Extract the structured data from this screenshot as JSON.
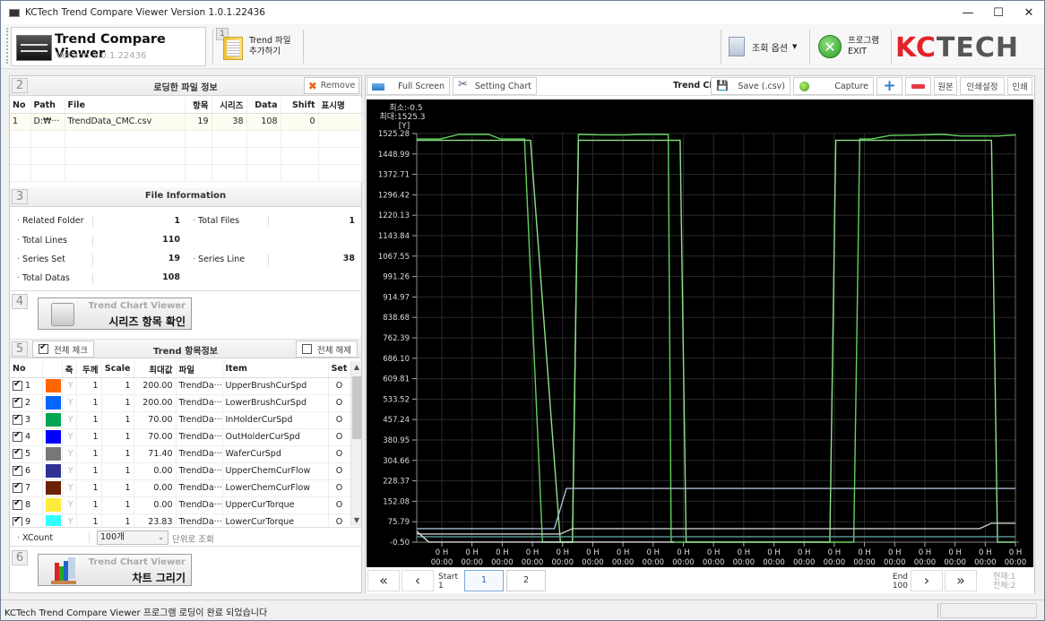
{
  "window": {
    "title": "KCTech Trend Compare Viewer Version 1.0.1.22436",
    "controls": {
      "minimize": "—",
      "maximize": "☐",
      "close": "✕"
    }
  },
  "toolbar": {
    "brand_name": "Trend Compare Viewer",
    "brand_version": "Version 1.0.1.22436",
    "add_file_step": "1",
    "add_file_line1": "Trend 파일",
    "add_file_line2": "추가하기",
    "options_label": "조회 옵션",
    "exit_line1": "프로그램",
    "exit_line2": "EXIT",
    "logo_k": "KC",
    "logo_rest": "TECH"
  },
  "loaded_files": {
    "step": "2",
    "title": "로딩한 파일 정보",
    "remove_label": "Remove",
    "columns": [
      "No",
      "Path",
      "File",
      "항목",
      "시리즈",
      "Data",
      "Shift",
      "표시명"
    ],
    "rows": [
      {
        "no": "1",
        "path": "D:₩···",
        "file": "TrendData_CMC.csv",
        "items": "19",
        "series": "38",
        "data": "108",
        "shift": "0",
        "display": ""
      }
    ]
  },
  "file_info": {
    "step": "3",
    "title": "File Information",
    "related_folder_label": "Related Folder",
    "related_folder": "1",
    "total_files_label": "Total Files",
    "total_files": "1",
    "total_lines_label": "Total Lines",
    "total_lines": "110",
    "series_set_label": "Series Set",
    "series_set": "19",
    "series_line_label": "Series Line",
    "series_line": "38",
    "total_datas_label": "Total Datas",
    "total_datas": "108"
  },
  "series_check": {
    "step": "4",
    "sub": "Trend Chart Viewer",
    "main": "시리즈 항목 확인"
  },
  "trend_items": {
    "step": "5",
    "check_all_label": "전체 체크",
    "title": "Trend 항목정보",
    "uncheck_all_label": "전체 해제",
    "columns": [
      "No",
      "",
      "축",
      "두께",
      "Scale",
      "최대값",
      "파일",
      "Item",
      "Set"
    ],
    "rows": [
      {
        "checked": true,
        "no": "1",
        "color": "#ff6600",
        "axis": "Y",
        "width": "1",
        "scale": "1",
        "max": "200.00",
        "file": "TrendDa···",
        "item": "UpperBrushCurSpd",
        "set": "O"
      },
      {
        "checked": true,
        "no": "2",
        "color": "#0066ff",
        "axis": "Y",
        "width": "1",
        "scale": "1",
        "max": "200.00",
        "file": "TrendDa···",
        "item": "LowerBrushCurSpd",
        "set": "O"
      },
      {
        "checked": true,
        "no": "3",
        "color": "#00a651",
        "axis": "Y",
        "width": "1",
        "scale": "1",
        "max": "70.00",
        "file": "TrendDa···",
        "item": "InHolderCurSpd",
        "set": "O"
      },
      {
        "checked": true,
        "no": "4",
        "color": "#0000ff",
        "axis": "Y",
        "width": "1",
        "scale": "1",
        "max": "70.00",
        "file": "TrendDa···",
        "item": "OutHolderCurSpd",
        "set": "O"
      },
      {
        "checked": true,
        "no": "5",
        "color": "#777777",
        "axis": "Y",
        "width": "1",
        "scale": "1",
        "max": "71.40",
        "file": "TrendDa···",
        "item": "WaferCurSpd",
        "set": "O"
      },
      {
        "checked": true,
        "no": "6",
        "color": "#2e3192",
        "axis": "Y",
        "width": "1",
        "scale": "1",
        "max": "0.00",
        "file": "TrendDa···",
        "item": "UpperChemCurFlow",
        "set": "O"
      },
      {
        "checked": true,
        "no": "7",
        "color": "#6b2200",
        "axis": "Y",
        "width": "1",
        "scale": "1",
        "max": "0.00",
        "file": "TrendDa···",
        "item": "LowerChemCurFlow",
        "set": "O"
      },
      {
        "checked": true,
        "no": "8",
        "color": "#ffeb3b",
        "axis": "Y",
        "width": "1",
        "scale": "1",
        "max": "0.00",
        "file": "TrendDa···",
        "item": "UpperCurTorque",
        "set": "O"
      },
      {
        "checked": true,
        "no": "9",
        "color": "#33ffff",
        "axis": "Y",
        "width": "1",
        "scale": "1",
        "max": "23.83",
        "file": "TrendDa···",
        "item": "LowerCurTorque",
        "set": "O"
      }
    ]
  },
  "xcount": {
    "label": "XCount",
    "value": "100개",
    "unit_label": "단위로 조회"
  },
  "draw_chart": {
    "step": "6",
    "sub": "Trend Chart Viewer",
    "main": "차트 그리기"
  },
  "chart_toolbar": {
    "full_screen": "Full Screen",
    "setting_chart": "Setting Chart",
    "chart_label": "Trend Ch",
    "save_csv": "Save (.csv)",
    "capture": "Capture",
    "zoom_in": "+",
    "zoom_out": "−",
    "original": "원본",
    "print_settings": "인쇄설정",
    "print": "인쇄"
  },
  "pager": {
    "first": "«",
    "prev": "‹",
    "start_label": "Start",
    "start_value": "1",
    "pages": [
      "1",
      "2"
    ],
    "active_page": "1",
    "end_label": "End",
    "end_value": "100",
    "next": "›",
    "last": "»",
    "current_label": "현재:1",
    "total_label": "전체:2"
  },
  "status": {
    "message": "KCTech Trend Compare Viewer 프로그램 로딩이 완료 되었습니다"
  },
  "chart_data": {
    "type": "line",
    "title": "",
    "min_label": "최소:-0.5",
    "max_label": "최대:1525.3",
    "ylabel": "[Y]",
    "xlabel": "",
    "ylim": [
      -0.5,
      1525.28
    ],
    "yticks": [
      "1525.28",
      "1448.99",
      "1372.71",
      "1296.42",
      "1220.13",
      "1143.84",
      "1067.55",
      "991.26",
      "914.97",
      "838.68",
      "762.39",
      "686.10",
      "609.81",
      "533.52",
      "457.24",
      "380.95",
      "304.66",
      "228.37",
      "152.08",
      "75.79",
      "-0.50"
    ],
    "ytick_values": [
      1525.28,
      1448.99,
      1372.71,
      1296.42,
      1220.13,
      1143.84,
      1067.55,
      991.26,
      914.97,
      838.68,
      762.39,
      686.1,
      609.81,
      533.52,
      457.24,
      380.95,
      304.66,
      228.37,
      152.08,
      75.79,
      -0.5
    ],
    "xlim": [
      0,
      100
    ],
    "xtick_labels": [
      "0 H\n00:00",
      "0 H\n00:00",
      "0 H\n00:00",
      "0 H\n00:00",
      "0 H\n00:00",
      "0 H\n00:00",
      "0 H\n00:00",
      "0 H\n00:00",
      "0 H\n00:00",
      "0 H\n00:00",
      "0 H\n00:00",
      "0 H\n00:00",
      "0 H\n00:00",
      "0 H\n00:00",
      "0 H\n00:00",
      "0 H\n00:00",
      "0 H\n00:00",
      "0 H\n00:00",
      "0 H\n00:00",
      "0 H\n00:00"
    ],
    "grid": true,
    "background": "#000000",
    "series": [
      {
        "name": "green-1",
        "color": "#5fd35a",
        "points": [
          [
            0,
            1505
          ],
          [
            4,
            1505
          ],
          [
            7,
            1522
          ],
          [
            12,
            1522
          ],
          [
            14,
            1505
          ],
          [
            18,
            1505
          ],
          [
            21,
            -0.5
          ],
          [
            26,
            -0.5
          ],
          [
            27,
            1522
          ],
          [
            31,
            1520
          ],
          [
            35,
            1520
          ],
          [
            37,
            1522
          ],
          [
            42,
            1522
          ],
          [
            42.5,
            -0.5
          ],
          [
            73,
            -0.5
          ],
          [
            74,
            1505
          ],
          [
            76,
            1505
          ],
          [
            79,
            1518
          ],
          [
            84,
            1520
          ],
          [
            88,
            1522
          ],
          [
            91,
            1516
          ],
          [
            97,
            1516
          ],
          [
            100,
            1520
          ]
        ]
      },
      {
        "name": "green-2",
        "color": "#8fe08a",
        "points": [
          [
            0,
            1500
          ],
          [
            18,
            1500
          ],
          [
            19,
            1500
          ],
          [
            24,
            -0.5
          ],
          [
            26,
            -0.5
          ],
          [
            27,
            1500
          ],
          [
            42,
            1500
          ],
          [
            44,
            1500
          ],
          [
            45,
            -0.5
          ],
          [
            69,
            -0.5
          ],
          [
            70,
            1500
          ],
          [
            96,
            1500
          ],
          [
            97,
            -0.5
          ],
          [
            100,
            -0.5
          ]
        ]
      },
      {
        "name": "steel",
        "color": "#a9b9d4",
        "points": [
          [
            0,
            50
          ],
          [
            23,
            50
          ],
          [
            25,
            200
          ],
          [
            100,
            200
          ]
        ]
      },
      {
        "name": "silver",
        "color": "#c8c8c8",
        "points": [
          [
            0,
            30
          ],
          [
            24,
            30
          ],
          [
            26,
            50
          ],
          [
            94,
            50
          ],
          [
            96,
            70
          ],
          [
            100,
            70
          ]
        ]
      },
      {
        "name": "teal",
        "color": "#5c9e99",
        "points": [
          [
            0,
            20
          ],
          [
            100,
            20
          ]
        ]
      },
      {
        "name": "white-low",
        "color": "#dddddd",
        "points": [
          [
            0,
            40
          ],
          [
            2,
            0
          ],
          [
            43,
            0
          ]
        ]
      }
    ]
  }
}
